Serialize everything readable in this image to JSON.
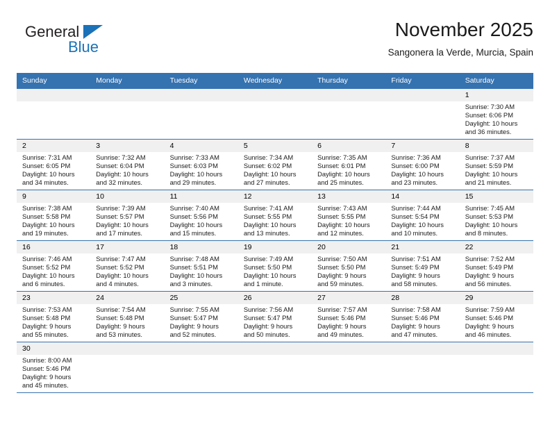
{
  "brand": {
    "name_part1": "General",
    "name_part2": "Blue",
    "logo_icon": "triangle-icon",
    "accent_color": "#1b72b8"
  },
  "header": {
    "title": "November 2025",
    "subtitle": "Sangonera la Verde, Murcia, Spain"
  },
  "theme": {
    "header_row_bg": "#3572b0",
    "daynum_bg": "#f0f0f0",
    "grid_line": "#3572b0",
    "text": "#1a1a1a"
  },
  "weekdays": [
    "Sunday",
    "Monday",
    "Tuesday",
    "Wednesday",
    "Thursday",
    "Friday",
    "Saturday"
  ],
  "labels": {
    "sunrise": "Sunrise:",
    "sunset": "Sunset:",
    "daylight": "Daylight:"
  },
  "weeks": [
    [
      {
        "day": "",
        "sunrise": "",
        "sunset": "",
        "daylight_line1": "",
        "daylight_line2": "",
        "blank": true
      },
      {
        "day": "",
        "sunrise": "",
        "sunset": "",
        "daylight_line1": "",
        "daylight_line2": "",
        "blank": true
      },
      {
        "day": "",
        "sunrise": "",
        "sunset": "",
        "daylight_line1": "",
        "daylight_line2": "",
        "blank": true
      },
      {
        "day": "",
        "sunrise": "",
        "sunset": "",
        "daylight_line1": "",
        "daylight_line2": "",
        "blank": true
      },
      {
        "day": "",
        "sunrise": "",
        "sunset": "",
        "daylight_line1": "",
        "daylight_line2": "",
        "blank": true
      },
      {
        "day": "",
        "sunrise": "",
        "sunset": "",
        "daylight_line1": "",
        "daylight_line2": "",
        "blank": true
      },
      {
        "day": "1",
        "sunrise": "Sunrise: 7:30 AM",
        "sunset": "Sunset: 6:06 PM",
        "daylight_line1": "Daylight: 10 hours",
        "daylight_line2": "and 36 minutes.",
        "blank": false
      }
    ],
    [
      {
        "day": "2",
        "sunrise": "Sunrise: 7:31 AM",
        "sunset": "Sunset: 6:05 PM",
        "daylight_line1": "Daylight: 10 hours",
        "daylight_line2": "and 34 minutes.",
        "blank": false
      },
      {
        "day": "3",
        "sunrise": "Sunrise: 7:32 AM",
        "sunset": "Sunset: 6:04 PM",
        "daylight_line1": "Daylight: 10 hours",
        "daylight_line2": "and 32 minutes.",
        "blank": false
      },
      {
        "day": "4",
        "sunrise": "Sunrise: 7:33 AM",
        "sunset": "Sunset: 6:03 PM",
        "daylight_line1": "Daylight: 10 hours",
        "daylight_line2": "and 29 minutes.",
        "blank": false
      },
      {
        "day": "5",
        "sunrise": "Sunrise: 7:34 AM",
        "sunset": "Sunset: 6:02 PM",
        "daylight_line1": "Daylight: 10 hours",
        "daylight_line2": "and 27 minutes.",
        "blank": false
      },
      {
        "day": "6",
        "sunrise": "Sunrise: 7:35 AM",
        "sunset": "Sunset: 6:01 PM",
        "daylight_line1": "Daylight: 10 hours",
        "daylight_line2": "and 25 minutes.",
        "blank": false
      },
      {
        "day": "7",
        "sunrise": "Sunrise: 7:36 AM",
        "sunset": "Sunset: 6:00 PM",
        "daylight_line1": "Daylight: 10 hours",
        "daylight_line2": "and 23 minutes.",
        "blank": false
      },
      {
        "day": "8",
        "sunrise": "Sunrise: 7:37 AM",
        "sunset": "Sunset: 5:59 PM",
        "daylight_line1": "Daylight: 10 hours",
        "daylight_line2": "and 21 minutes.",
        "blank": false
      }
    ],
    [
      {
        "day": "9",
        "sunrise": "Sunrise: 7:38 AM",
        "sunset": "Sunset: 5:58 PM",
        "daylight_line1": "Daylight: 10 hours",
        "daylight_line2": "and 19 minutes.",
        "blank": false
      },
      {
        "day": "10",
        "sunrise": "Sunrise: 7:39 AM",
        "sunset": "Sunset: 5:57 PM",
        "daylight_line1": "Daylight: 10 hours",
        "daylight_line2": "and 17 minutes.",
        "blank": false
      },
      {
        "day": "11",
        "sunrise": "Sunrise: 7:40 AM",
        "sunset": "Sunset: 5:56 PM",
        "daylight_line1": "Daylight: 10 hours",
        "daylight_line2": "and 15 minutes.",
        "blank": false
      },
      {
        "day": "12",
        "sunrise": "Sunrise: 7:41 AM",
        "sunset": "Sunset: 5:55 PM",
        "daylight_line1": "Daylight: 10 hours",
        "daylight_line2": "and 13 minutes.",
        "blank": false
      },
      {
        "day": "13",
        "sunrise": "Sunrise: 7:43 AM",
        "sunset": "Sunset: 5:55 PM",
        "daylight_line1": "Daylight: 10 hours",
        "daylight_line2": "and 12 minutes.",
        "blank": false
      },
      {
        "day": "14",
        "sunrise": "Sunrise: 7:44 AM",
        "sunset": "Sunset: 5:54 PM",
        "daylight_line1": "Daylight: 10 hours",
        "daylight_line2": "and 10 minutes.",
        "blank": false
      },
      {
        "day": "15",
        "sunrise": "Sunrise: 7:45 AM",
        "sunset": "Sunset: 5:53 PM",
        "daylight_line1": "Daylight: 10 hours",
        "daylight_line2": "and 8 minutes.",
        "blank": false
      }
    ],
    [
      {
        "day": "16",
        "sunrise": "Sunrise: 7:46 AM",
        "sunset": "Sunset: 5:52 PM",
        "daylight_line1": "Daylight: 10 hours",
        "daylight_line2": "and 6 minutes.",
        "blank": false
      },
      {
        "day": "17",
        "sunrise": "Sunrise: 7:47 AM",
        "sunset": "Sunset: 5:52 PM",
        "daylight_line1": "Daylight: 10 hours",
        "daylight_line2": "and 4 minutes.",
        "blank": false
      },
      {
        "day": "18",
        "sunrise": "Sunrise: 7:48 AM",
        "sunset": "Sunset: 5:51 PM",
        "daylight_line1": "Daylight: 10 hours",
        "daylight_line2": "and 3 minutes.",
        "blank": false
      },
      {
        "day": "19",
        "sunrise": "Sunrise: 7:49 AM",
        "sunset": "Sunset: 5:50 PM",
        "daylight_line1": "Daylight: 10 hours",
        "daylight_line2": "and 1 minute.",
        "blank": false
      },
      {
        "day": "20",
        "sunrise": "Sunrise: 7:50 AM",
        "sunset": "Sunset: 5:50 PM",
        "daylight_line1": "Daylight: 9 hours",
        "daylight_line2": "and 59 minutes.",
        "blank": false
      },
      {
        "day": "21",
        "sunrise": "Sunrise: 7:51 AM",
        "sunset": "Sunset: 5:49 PM",
        "daylight_line1": "Daylight: 9 hours",
        "daylight_line2": "and 58 minutes.",
        "blank": false
      },
      {
        "day": "22",
        "sunrise": "Sunrise: 7:52 AM",
        "sunset": "Sunset: 5:49 PM",
        "daylight_line1": "Daylight: 9 hours",
        "daylight_line2": "and 56 minutes.",
        "blank": false
      }
    ],
    [
      {
        "day": "23",
        "sunrise": "Sunrise: 7:53 AM",
        "sunset": "Sunset: 5:48 PM",
        "daylight_line1": "Daylight: 9 hours",
        "daylight_line2": "and 55 minutes.",
        "blank": false
      },
      {
        "day": "24",
        "sunrise": "Sunrise: 7:54 AM",
        "sunset": "Sunset: 5:48 PM",
        "daylight_line1": "Daylight: 9 hours",
        "daylight_line2": "and 53 minutes.",
        "blank": false
      },
      {
        "day": "25",
        "sunrise": "Sunrise: 7:55 AM",
        "sunset": "Sunset: 5:47 PM",
        "daylight_line1": "Daylight: 9 hours",
        "daylight_line2": "and 52 minutes.",
        "blank": false
      },
      {
        "day": "26",
        "sunrise": "Sunrise: 7:56 AM",
        "sunset": "Sunset: 5:47 PM",
        "daylight_line1": "Daylight: 9 hours",
        "daylight_line2": "and 50 minutes.",
        "blank": false
      },
      {
        "day": "27",
        "sunrise": "Sunrise: 7:57 AM",
        "sunset": "Sunset: 5:46 PM",
        "daylight_line1": "Daylight: 9 hours",
        "daylight_line2": "and 49 minutes.",
        "blank": false
      },
      {
        "day": "28",
        "sunrise": "Sunrise: 7:58 AM",
        "sunset": "Sunset: 5:46 PM",
        "daylight_line1": "Daylight: 9 hours",
        "daylight_line2": "and 47 minutes.",
        "blank": false
      },
      {
        "day": "29",
        "sunrise": "Sunrise: 7:59 AM",
        "sunset": "Sunset: 5:46 PM",
        "daylight_line1": "Daylight: 9 hours",
        "daylight_line2": "and 46 minutes.",
        "blank": false
      }
    ],
    [
      {
        "day": "30",
        "sunrise": "Sunrise: 8:00 AM",
        "sunset": "Sunset: 5:46 PM",
        "daylight_line1": "Daylight: 9 hours",
        "daylight_line2": "and 45 minutes.",
        "blank": false
      },
      {
        "day": "",
        "sunrise": "",
        "sunset": "",
        "daylight_line1": "",
        "daylight_line2": "",
        "blank": true
      },
      {
        "day": "",
        "sunrise": "",
        "sunset": "",
        "daylight_line1": "",
        "daylight_line2": "",
        "blank": true
      },
      {
        "day": "",
        "sunrise": "",
        "sunset": "",
        "daylight_line1": "",
        "daylight_line2": "",
        "blank": true
      },
      {
        "day": "",
        "sunrise": "",
        "sunset": "",
        "daylight_line1": "",
        "daylight_line2": "",
        "blank": true
      },
      {
        "day": "",
        "sunrise": "",
        "sunset": "",
        "daylight_line1": "",
        "daylight_line2": "",
        "blank": true
      },
      {
        "day": "",
        "sunrise": "",
        "sunset": "",
        "daylight_line1": "",
        "daylight_line2": "",
        "blank": true
      }
    ]
  ]
}
